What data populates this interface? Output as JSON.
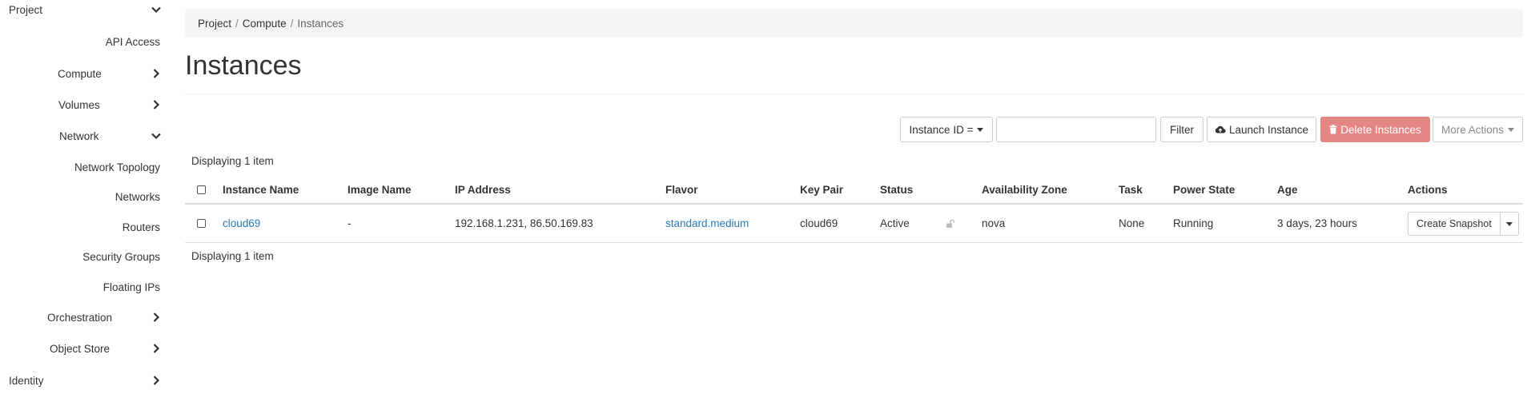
{
  "sidebar": {
    "project": "Project",
    "api_access": "API Access",
    "compute": "Compute",
    "volumes": "Volumes",
    "network": "Network",
    "network_topology": "Network Topology",
    "networks": "Networks",
    "routers": "Routers",
    "security_groups": "Security Groups",
    "floating_ips": "Floating IPs",
    "orchestration": "Orchestration",
    "object_store": "Object Store",
    "identity": "Identity"
  },
  "breadcrumb": {
    "items": [
      "Project",
      "Compute",
      "Instances"
    ],
    "sep": "/"
  },
  "page": {
    "title": "Instances"
  },
  "toolbar": {
    "filter_field": "Instance ID =",
    "filter_value": "",
    "filter_label": "Filter",
    "launch_label": "Launch Instance",
    "delete_label": "Delete Instances",
    "more_label": "More Actions"
  },
  "table": {
    "count_top": "Displaying 1 item",
    "count_bottom": "Displaying 1 item",
    "headers": [
      "Instance Name",
      "Image Name",
      "IP Address",
      "Flavor",
      "Key Pair",
      "Status",
      "Availability Zone",
      "Task",
      "Power State",
      "Age",
      "Actions"
    ],
    "rows": [
      {
        "instance_name": "cloud69",
        "image_name": "-",
        "ip_address": "192.168.1.231, 86.50.169.83",
        "flavor": "standard.medium",
        "key_pair": "cloud69",
        "status": "Active",
        "availability_zone": "nova",
        "task": "None",
        "power_state": "Running",
        "age": "3 days, 23 hours",
        "action": "Create Snapshot"
      }
    ]
  },
  "colors": {
    "link": "#2a7ab8",
    "danger": "#e48683",
    "breadcrumb_bg": "#f5f5f5"
  }
}
